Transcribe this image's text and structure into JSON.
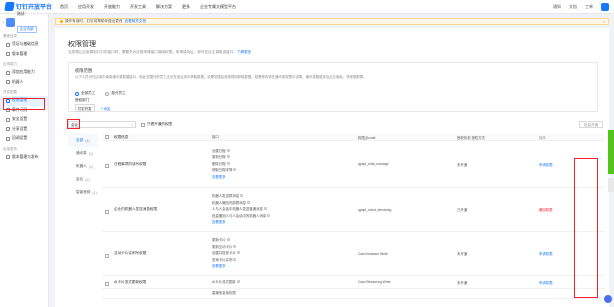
{
  "topbar": {
    "logo": "钉钉开放平台",
    "nav": [
      "首页",
      "应用开发",
      "开放能力",
      "开发工具",
      "解决方案",
      "更多",
      "企业专属大模型平台"
    ],
    "right": [
      "通知",
      "文档",
      "工单"
    ]
  },
  "sidebar": {
    "app_name": "测试",
    "app_badge": "企业内部",
    "groups": [
      {
        "title": "基础信息",
        "items": [
          "凭证与基础信息",
          "版本管理"
        ]
      },
      {
        "title": "应用能力",
        "items": [
          "添加应用能力",
          "机器人"
        ]
      },
      {
        "title": "开发配置",
        "items": [
          "权限管理",
          "事件订阅",
          "安全设置",
          "分享设置",
          "回调设置"
        ]
      },
      {
        "title": "应用发布",
        "items": [
          "版本管理与发布"
        ]
      }
    ],
    "active_item": "权限管理"
  },
  "notice": {
    "text": "操作有误时，钉钉将帮助你做出更改",
    "link": "查看相关文档"
  },
  "main": {
    "title": "权限管理",
    "desc": "当您想让应用调用钉钉的接口时，需要先为应用申请接口调用权限。申请成功后，即可在自主调用该接口。",
    "desc_link": "了解更多",
    "card": {
      "title": "权限范围",
      "desc": "以下人员可在应用中使用通讯录数据接口，除此范围外的员工无法在该应用中获取数据。设置范围后请按规则获取数据，若需修改请在通讯录权限中设置。通讯录数据涉及企业隐私，请谨慎配置。",
      "radio_all": "全部员工",
      "radio_part": "部分员工",
      "auth_label": "授权部门",
      "tag": "钉钉开发",
      "add": "+ 添加"
    },
    "search_value": "会议",
    "only_unapplied": "只看开通的权限",
    "batch_button": "批量开通"
  },
  "categories": [
    {
      "label": "全部",
      "count": "(4)"
    },
    {
      "label": "通讯录",
      "count": "(1)"
    },
    {
      "label": "机器人",
      "count": "(1)"
    },
    {
      "label": "会议",
      "count": "(1)"
    },
    {
      "label": "智能音频",
      "count": "(1)"
    }
  ],
  "table": {
    "headers": [
      "",
      "权限信息",
      "接口",
      "权限点code",
      "授权状态 授权方式",
      "操作"
    ],
    "rows": [
      {
        "name": "日程事项的读写权限",
        "apis": [
          "创建日程",
          "更新日程",
          "删除日程",
          "获取日程详情",
          "查询日程列表"
        ],
        "more": "查看更多",
        "code": "qyapi_chat_manage",
        "status": "未开通",
        "op": "申请权限"
      },
      {
        "name": "企业内机器人发送消息权限",
        "apis": [
          "机器人发送群消息",
          "机器人撤回内部群消息",
          "人与人会话中机器人发送普通消息",
          "批量撤回人与人会话中的机器人消息"
        ],
        "more": "查看更多",
        "code": "qyapi_robot_sendmsg",
        "status": "已开通",
        "op": "撤回权限"
      },
      {
        "name": "互动卡片实例写权限",
        "apis": [
          "更新卡片",
          "更新互动卡片",
          "创建并投放卡片",
          "查询卡片实例",
          "更新卡片数据"
        ],
        "more": "查看更多",
        "code": "Card.Instance.Write",
        "status": "未开通",
        "op": "申请权限"
      },
      {
        "name": "AI卡片流式更新权限",
        "apis": [
          "AI卡片流式更新"
        ],
        "more": "",
        "code": "Card.Streaming.Write",
        "status": "未开通",
        "op": "申请权限"
      }
    ],
    "last_partial": "直播信息读权限"
  },
  "colors": {
    "accent": "#1677ff",
    "highlight": "#f5222d"
  }
}
